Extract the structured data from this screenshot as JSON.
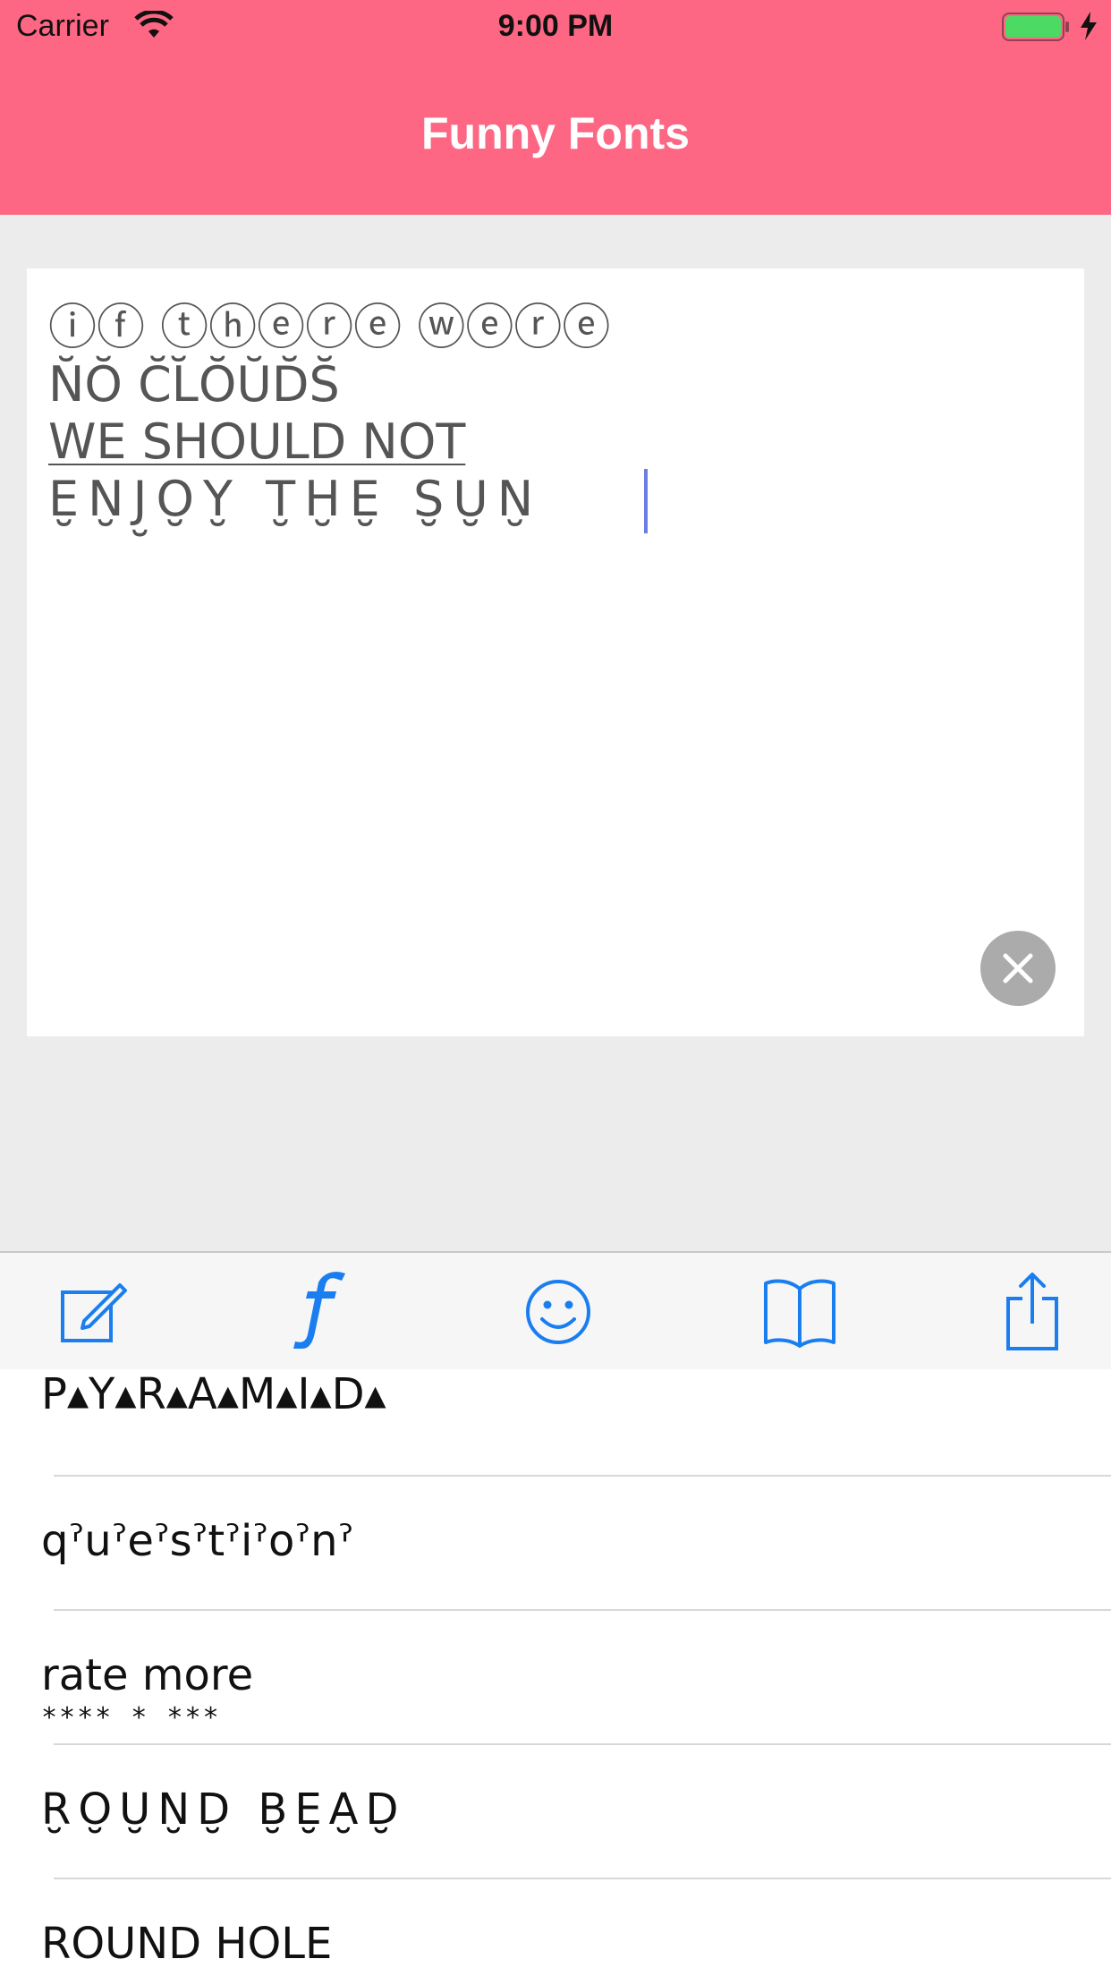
{
  "status_bar": {
    "carrier": "Carrier",
    "time": "9:00 PM",
    "icons": [
      "wifi-icon",
      "battery-icon",
      "charging-bolt-icon"
    ]
  },
  "nav": {
    "title": "Funny Fonts",
    "background_color": "#fd6784"
  },
  "editor": {
    "lines": [
      "ⓘⓕ ⓣⓗⓔⓡⓔ ⓦⓔⓡⓔ",
      "N̆Ŏ C̆L̆ŎŬD̆S̆",
      "WE SHOULD NOT",
      "E̮N̮J̮O̮Y̮ T̮ḪE̮ S̮U̮N̮"
    ],
    "clear_icon": "clear-icon"
  },
  "toolbar": {
    "items": [
      {
        "name": "edit",
        "icon": "compose-icon"
      },
      {
        "name": "fonts",
        "icon": "font-f-icon"
      },
      {
        "name": "emoji",
        "icon": "smiley-icon"
      },
      {
        "name": "library",
        "icon": "book-icon"
      },
      {
        "name": "share",
        "icon": "share-icon"
      }
    ],
    "accent_color": "#1a7ef0"
  },
  "font_list": {
    "items": [
      {
        "label": "P▴Y▴R▴A▴M▴I▴D▴"
      },
      {
        "label": "qˀuˀeˀsˀtˀiˀoˀnˀ"
      },
      {
        "label": "rate more",
        "sublabel": "****  * ***"
      },
      {
        "label": "R̮O̮U̮N̮D̮ B̮E̮A̮D̮"
      },
      {
        "label": "ROUND HOLE"
      }
    ]
  }
}
